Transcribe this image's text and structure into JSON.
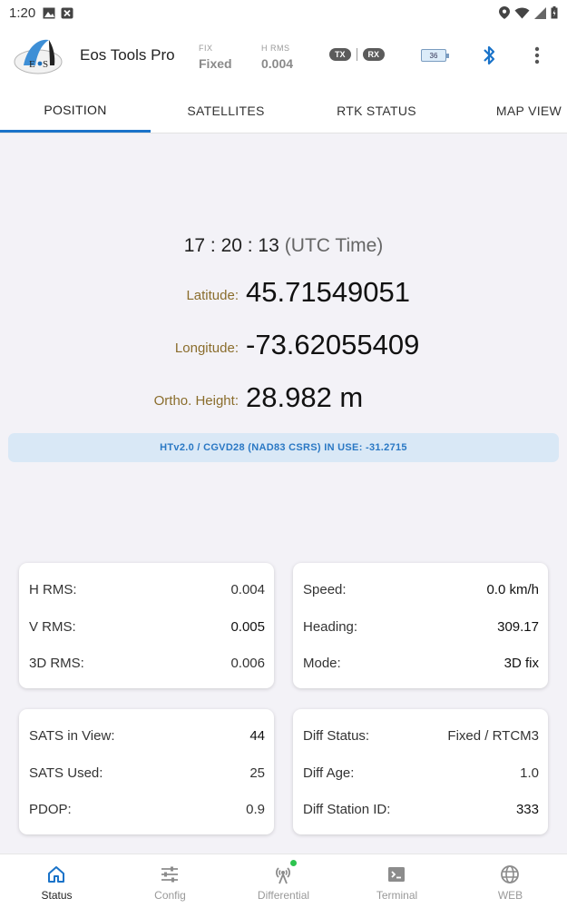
{
  "status_bar": {
    "time": "1:20"
  },
  "app": {
    "title": "Eos Tools Pro",
    "logo_text": "EOS"
  },
  "header": {
    "fix_label": "FIX",
    "fix_value": "Fixed",
    "hrms_label": "H RMS",
    "hrms_value": "0.004",
    "tx_label": "TX",
    "rx_label": "RX",
    "battery_level": "36"
  },
  "tabs": [
    {
      "label": "POSITION",
      "active": true
    },
    {
      "label": "SATELLITES",
      "active": false
    },
    {
      "label": "RTK STATUS",
      "active": false
    },
    {
      "label": "MAP VIEW",
      "active": false
    }
  ],
  "position": {
    "time": "17 : 20 : 13",
    "time_zone": "(UTC Time)",
    "latitude_label": "Latitude:",
    "latitude": "45.71549051",
    "longitude_label": "Longitude:",
    "longitude": "-73.62055409",
    "height_label": "Ortho. Height:",
    "height": "28.982 m",
    "geoid_banner": "HTv2.0 / CGVD28 (NAD83 CSRS) IN USE: -31.2715"
  },
  "cards": {
    "rms": [
      {
        "label": "H RMS:",
        "value": "0.004"
      },
      {
        "label": "V RMS:",
        "value": "0.005"
      },
      {
        "label": "3D RMS:",
        "value": "0.006"
      }
    ],
    "motion": [
      {
        "label": "Speed:",
        "value": "0.0 km/h"
      },
      {
        "label": "Heading:",
        "value": "309.17"
      },
      {
        "label": "Mode:",
        "value": "3D fix"
      }
    ],
    "sats": [
      {
        "label": "SATS in View:",
        "value": "44"
      },
      {
        "label": "SATS Used:",
        "value": "25"
      },
      {
        "label": "PDOP:",
        "value": "0.9"
      }
    ],
    "diff": [
      {
        "label": "Diff Status:",
        "value": "Fixed / RTCM3"
      },
      {
        "label": "Diff Age:",
        "value": "1.0"
      },
      {
        "label": "Diff Station ID:",
        "value": "333"
      }
    ]
  },
  "bottom_nav": [
    {
      "label": "Status",
      "icon": "home-icon",
      "active": true
    },
    {
      "label": "Config",
      "icon": "sliders-icon",
      "active": false
    },
    {
      "label": "Differential",
      "icon": "antenna-icon",
      "active": false
    },
    {
      "label": "Terminal",
      "icon": "terminal-icon",
      "active": false
    },
    {
      "label": "WEB",
      "icon": "globe-icon",
      "active": false
    }
  ],
  "colors": {
    "accent": "#1a73c9",
    "label_gold": "#8a6d2c",
    "banner_bg": "#d9e8f6",
    "status_dot": "#2ec44f"
  }
}
